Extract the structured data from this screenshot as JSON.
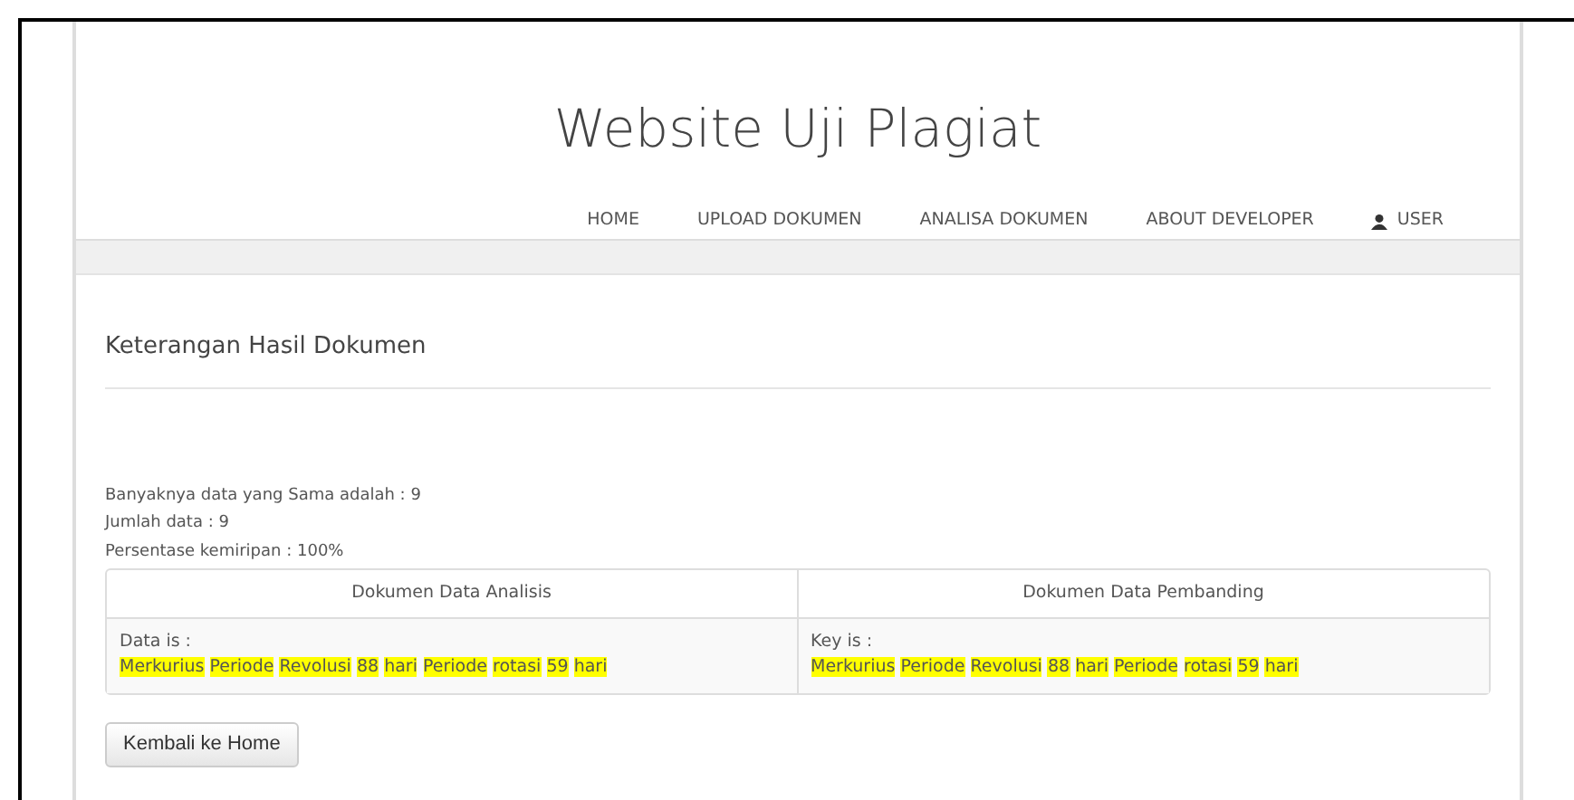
{
  "site_title": "Website Uji Plagiat",
  "nav": [
    {
      "label": "HOME",
      "kind": "link"
    },
    {
      "label": "UPLOAD DOKUMEN",
      "kind": "link"
    },
    {
      "label": "ANALISA DOKUMEN",
      "kind": "link"
    },
    {
      "label": "ABOUT DEVELOPER",
      "kind": "link"
    },
    {
      "label": "USER",
      "kind": "user"
    }
  ],
  "section_title": "Keterangan Hasil Dokumen",
  "stats": [
    "Banyaknya data yang Sama adalah : 9",
    "Jumlah data : 9",
    "Persentase kemiripan : 100%"
  ],
  "table": {
    "columns": [
      "Dokumen Data Analisis",
      "Dokumen Data Pembanding"
    ],
    "cells": [
      {
        "label": "Data is :",
        "words": [
          {
            "text": "Merkurius",
            "highlighted": true
          },
          {
            "text": "Periode",
            "highlighted": true
          },
          {
            "text": "Revolusi",
            "highlighted": true
          },
          {
            "text": "88",
            "highlighted": true
          },
          {
            "text": "hari",
            "highlighted": true
          },
          {
            "text": "Periode",
            "highlighted": true
          },
          {
            "text": "rotasi",
            "highlighted": true
          },
          {
            "text": "59",
            "highlighted": true
          },
          {
            "text": "hari",
            "highlighted": true
          }
        ]
      },
      {
        "label": "Key is :",
        "words": [
          {
            "text": "Merkurius",
            "highlighted": true
          },
          {
            "text": "Periode",
            "highlighted": true
          },
          {
            "text": "Revolusi",
            "highlighted": true
          },
          {
            "text": "88",
            "highlighted": true
          },
          {
            "text": "hari",
            "highlighted": true
          },
          {
            "text": "Periode",
            "highlighted": true
          },
          {
            "text": "rotasi",
            "highlighted": true
          },
          {
            "text": "59",
            "highlighted": true
          },
          {
            "text": "hari",
            "highlighted": true
          }
        ]
      }
    ]
  },
  "button": "Kembali ke Home"
}
